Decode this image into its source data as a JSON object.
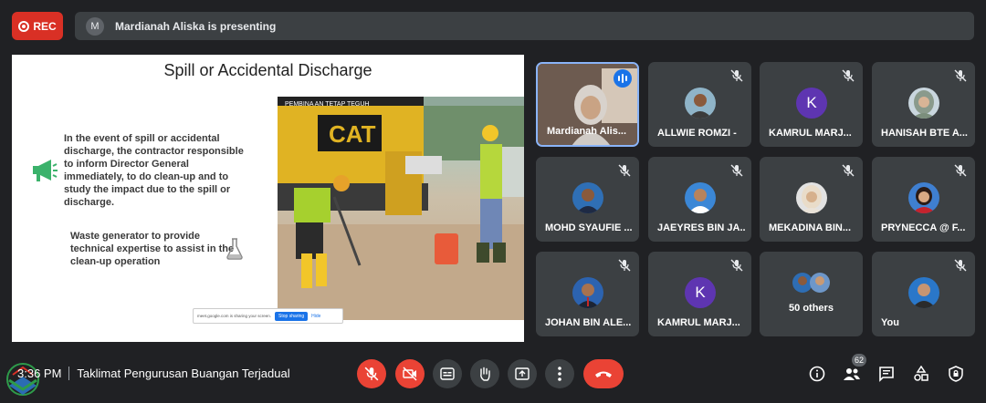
{
  "top_bar": {
    "rec_label": "REC",
    "presenter_initial": "M",
    "presenting_text": "Mardianah Aliska is presenting"
  },
  "slide": {
    "title": "Spill or Accidental Discharge",
    "paragraph_1": "In the event of spill or accidental discharge, the contractor responsible to inform Director General immediately, to do clean-up and to study the impact due to the spill or discharge.",
    "paragraph_2": "Waste generator to provide technical expertise to assist in the clean-up operation",
    "share_notice": "meet.google.com is sharing your screen.",
    "share_stop": "Stop sharing",
    "share_hide": "Hide",
    "photo_sign": "PEMBINA AN TETAP TEGUH",
    "photo_brand": "CAT"
  },
  "participants": [
    {
      "name": "Mardianah Alis...",
      "avatar": "photo",
      "active": true
    },
    {
      "name": "ALLWIE ROMZI -",
      "avatar": "photo"
    },
    {
      "name": "KAMRUL MARJ...",
      "avatar": "letter",
      "initial": "K"
    },
    {
      "name": "HANISAH BTE A...",
      "avatar": "photo"
    },
    {
      "name": "MOHD SYAUFIE ...",
      "avatar": "photo"
    },
    {
      "name": "JAEYRES BIN JA...",
      "avatar": "photo"
    },
    {
      "name": "MEKADINA BIN...",
      "avatar": "photo"
    },
    {
      "name": "PRYNECCA @ F...",
      "avatar": "photo"
    },
    {
      "name": "JOHAN BIN ALE...",
      "avatar": "photo"
    },
    {
      "name": "KAMRUL MARJ...",
      "avatar": "letter",
      "initial": "K"
    },
    {
      "name": "50 others",
      "avatar": "group"
    },
    {
      "name": "You",
      "avatar": "photo"
    }
  ],
  "bottom_bar": {
    "time": "3:36 PM",
    "meeting_title": "Taklimat Pengurusan Buangan Terjadual",
    "people_count": "62"
  },
  "colors": {
    "background": "#202124",
    "tile": "#3c4043",
    "danger": "#ea4335",
    "accent": "#8ab4f8"
  }
}
